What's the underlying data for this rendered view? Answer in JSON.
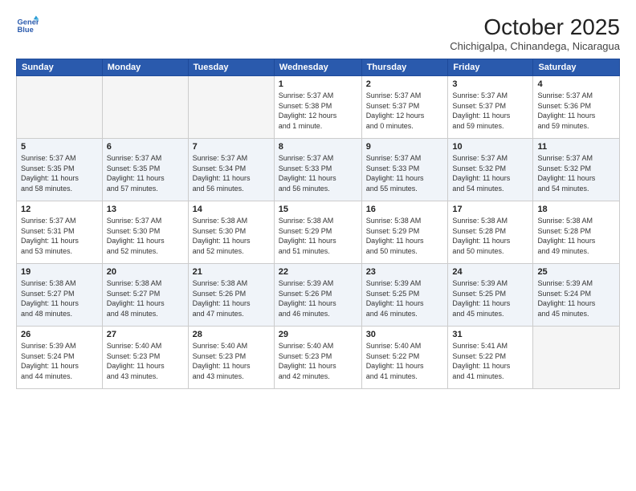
{
  "header": {
    "logo_line1": "General",
    "logo_line2": "Blue",
    "title": "October 2025",
    "subtitle": "Chichigalpa, Chinandega, Nicaragua"
  },
  "columns": [
    "Sunday",
    "Monday",
    "Tuesday",
    "Wednesday",
    "Thursday",
    "Friday",
    "Saturday"
  ],
  "weeks": [
    [
      {
        "day": "",
        "info": ""
      },
      {
        "day": "",
        "info": ""
      },
      {
        "day": "",
        "info": ""
      },
      {
        "day": "1",
        "info": "Sunrise: 5:37 AM\nSunset: 5:38 PM\nDaylight: 12 hours\nand 1 minute."
      },
      {
        "day": "2",
        "info": "Sunrise: 5:37 AM\nSunset: 5:37 PM\nDaylight: 12 hours\nand 0 minutes."
      },
      {
        "day": "3",
        "info": "Sunrise: 5:37 AM\nSunset: 5:37 PM\nDaylight: 11 hours\nand 59 minutes."
      },
      {
        "day": "4",
        "info": "Sunrise: 5:37 AM\nSunset: 5:36 PM\nDaylight: 11 hours\nand 59 minutes."
      }
    ],
    [
      {
        "day": "5",
        "info": "Sunrise: 5:37 AM\nSunset: 5:35 PM\nDaylight: 11 hours\nand 58 minutes."
      },
      {
        "day": "6",
        "info": "Sunrise: 5:37 AM\nSunset: 5:35 PM\nDaylight: 11 hours\nand 57 minutes."
      },
      {
        "day": "7",
        "info": "Sunrise: 5:37 AM\nSunset: 5:34 PM\nDaylight: 11 hours\nand 56 minutes."
      },
      {
        "day": "8",
        "info": "Sunrise: 5:37 AM\nSunset: 5:33 PM\nDaylight: 11 hours\nand 56 minutes."
      },
      {
        "day": "9",
        "info": "Sunrise: 5:37 AM\nSunset: 5:33 PM\nDaylight: 11 hours\nand 55 minutes."
      },
      {
        "day": "10",
        "info": "Sunrise: 5:37 AM\nSunset: 5:32 PM\nDaylight: 11 hours\nand 54 minutes."
      },
      {
        "day": "11",
        "info": "Sunrise: 5:37 AM\nSunset: 5:32 PM\nDaylight: 11 hours\nand 54 minutes."
      }
    ],
    [
      {
        "day": "12",
        "info": "Sunrise: 5:37 AM\nSunset: 5:31 PM\nDaylight: 11 hours\nand 53 minutes."
      },
      {
        "day": "13",
        "info": "Sunrise: 5:37 AM\nSunset: 5:30 PM\nDaylight: 11 hours\nand 52 minutes."
      },
      {
        "day": "14",
        "info": "Sunrise: 5:38 AM\nSunset: 5:30 PM\nDaylight: 11 hours\nand 52 minutes."
      },
      {
        "day": "15",
        "info": "Sunrise: 5:38 AM\nSunset: 5:29 PM\nDaylight: 11 hours\nand 51 minutes."
      },
      {
        "day": "16",
        "info": "Sunrise: 5:38 AM\nSunset: 5:29 PM\nDaylight: 11 hours\nand 50 minutes."
      },
      {
        "day": "17",
        "info": "Sunrise: 5:38 AM\nSunset: 5:28 PM\nDaylight: 11 hours\nand 50 minutes."
      },
      {
        "day": "18",
        "info": "Sunrise: 5:38 AM\nSunset: 5:28 PM\nDaylight: 11 hours\nand 49 minutes."
      }
    ],
    [
      {
        "day": "19",
        "info": "Sunrise: 5:38 AM\nSunset: 5:27 PM\nDaylight: 11 hours\nand 48 minutes."
      },
      {
        "day": "20",
        "info": "Sunrise: 5:38 AM\nSunset: 5:27 PM\nDaylight: 11 hours\nand 48 minutes."
      },
      {
        "day": "21",
        "info": "Sunrise: 5:38 AM\nSunset: 5:26 PM\nDaylight: 11 hours\nand 47 minutes."
      },
      {
        "day": "22",
        "info": "Sunrise: 5:39 AM\nSunset: 5:26 PM\nDaylight: 11 hours\nand 46 minutes."
      },
      {
        "day": "23",
        "info": "Sunrise: 5:39 AM\nSunset: 5:25 PM\nDaylight: 11 hours\nand 46 minutes."
      },
      {
        "day": "24",
        "info": "Sunrise: 5:39 AM\nSunset: 5:25 PM\nDaylight: 11 hours\nand 45 minutes."
      },
      {
        "day": "25",
        "info": "Sunrise: 5:39 AM\nSunset: 5:24 PM\nDaylight: 11 hours\nand 45 minutes."
      }
    ],
    [
      {
        "day": "26",
        "info": "Sunrise: 5:39 AM\nSunset: 5:24 PM\nDaylight: 11 hours\nand 44 minutes."
      },
      {
        "day": "27",
        "info": "Sunrise: 5:40 AM\nSunset: 5:23 PM\nDaylight: 11 hours\nand 43 minutes."
      },
      {
        "day": "28",
        "info": "Sunrise: 5:40 AM\nSunset: 5:23 PM\nDaylight: 11 hours\nand 43 minutes."
      },
      {
        "day": "29",
        "info": "Sunrise: 5:40 AM\nSunset: 5:23 PM\nDaylight: 11 hours\nand 42 minutes."
      },
      {
        "day": "30",
        "info": "Sunrise: 5:40 AM\nSunset: 5:22 PM\nDaylight: 11 hours\nand 41 minutes."
      },
      {
        "day": "31",
        "info": "Sunrise: 5:41 AM\nSunset: 5:22 PM\nDaylight: 11 hours\nand 41 minutes."
      },
      {
        "day": "",
        "info": ""
      }
    ]
  ]
}
